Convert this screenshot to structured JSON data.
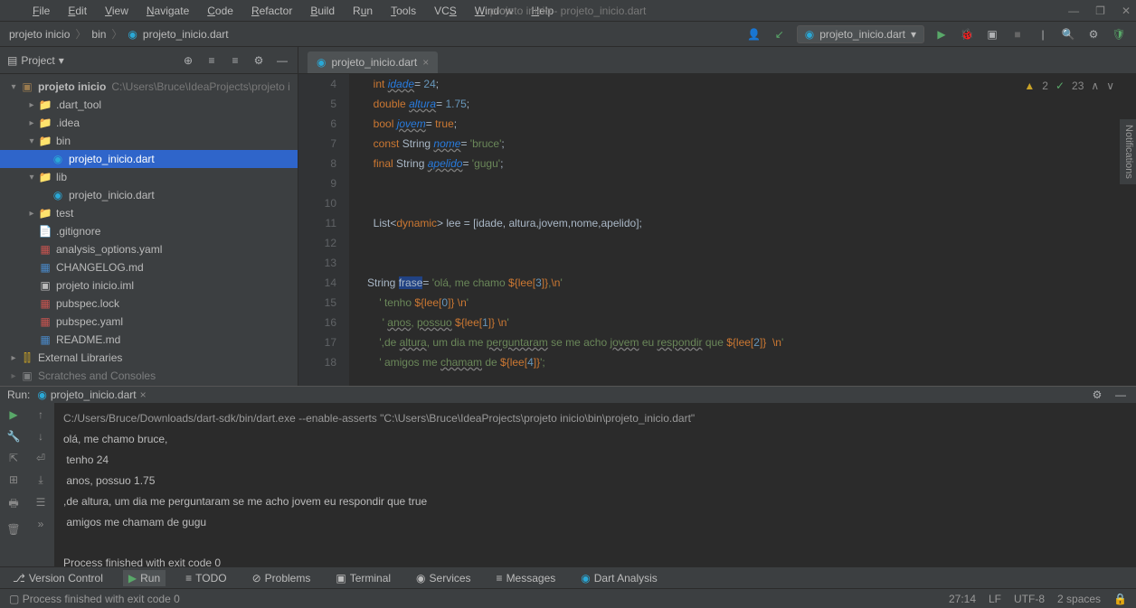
{
  "window": {
    "title": "projeto inicio - projeto_inicio.dart"
  },
  "menu": {
    "file": "File",
    "edit": "Edit",
    "view": "View",
    "navigate": "Navigate",
    "code": "Code",
    "refactor": "Refactor",
    "build": "Build",
    "run": "Run",
    "tools": "Tools",
    "vcs": "VCS",
    "window": "Window",
    "help": "Help"
  },
  "breadcrumb": {
    "a": "projeto inicio",
    "b": "bin",
    "c": "projeto_inicio.dart"
  },
  "runConfig": {
    "label": "projeto_inicio.dart"
  },
  "projectPanel": {
    "title": "Project"
  },
  "tree": {
    "root": {
      "name": "projeto inicio",
      "path": "C:\\Users\\Bruce\\IdeaProjects\\projeto i"
    },
    "dart_tool": ".dart_tool",
    "idea": ".idea",
    "bin": "bin",
    "bin_file": "projeto_inicio.dart",
    "lib": "lib",
    "lib_file": "projeto_inicio.dart",
    "test": "test",
    "gitignore": ".gitignore",
    "analysis": "analysis_options.yaml",
    "changelog": "CHANGELOG.md",
    "iml": "projeto inicio.iml",
    "publock": "pubspec.lock",
    "pubyaml": "pubspec.yaml",
    "readme": "README.md",
    "extlib": "External Libraries",
    "scratches": "Scratches and Consoles"
  },
  "tab": {
    "name": "projeto_inicio.dart"
  },
  "badges": {
    "warn": "2",
    "ok": "23"
  },
  "gutter": [
    "4",
    "5",
    "6",
    "7",
    "8",
    "9",
    "10",
    "11",
    "12",
    "13",
    "14",
    "15",
    "16",
    "17",
    "18"
  ],
  "code": {
    "l4": {
      "kw": "int",
      "var": "idade",
      "val": "24"
    },
    "l5": {
      "kw": "double",
      "var": "altura",
      "val": "1.75"
    },
    "l6": {
      "kw": "bool",
      "var": "jovem",
      "val": "true"
    },
    "l7": {
      "kw": "const",
      "type": "String",
      "var": "nome",
      "val": "'bruce'"
    },
    "l8": {
      "kw": "final",
      "type": "String",
      "var": "apelido",
      "val": "'gugu'"
    },
    "l11": {
      "text": "List<dynamic> lee = [idade, altura,jovem,nome,apelido];"
    },
    "l14": {
      "pre": "String ",
      "frase": "frase",
      "t1": "= ",
      "s1": "'olá, me chamo ",
      "i1": "${lee[",
      "n1": "3",
      "i2": "]}",
      "s2": ",",
      "esc": "\\n",
      "s3": "'"
    },
    "l15": {
      "s1": "' tenho ",
      "i1": "${lee[",
      "n1": "0",
      "i2": "]}",
      "s2": " ",
      "esc": "\\n",
      "s3": "'"
    },
    "l16": {
      "s1": "' ",
      "w1": "anos",
      "s2": ", ",
      "w2": "possuo",
      "s3": " ",
      "i1": "${lee[",
      "n1": "1",
      "i2": "]}",
      "s4": " ",
      "esc": "\\n",
      "s5": "'"
    },
    "l17": {
      "s1": "',de ",
      "w1": "altura",
      "s2": ", um dia me ",
      "w2": "perguntaram",
      "s3": " se me acho ",
      "w3": "jovem",
      "s4": " eu ",
      "w4": "respondir",
      "s5": " que ",
      "i1": "${lee[",
      "n1": "2",
      "i2": "]}",
      "s6": "  ",
      "esc": "\\n",
      "s7": "'"
    },
    "l18": {
      "s1": "' amigos me ",
      "w1": "chamam",
      "s2": " de ",
      "i1": "${lee[",
      "n1": "4",
      "i2": "]}",
      "s3": "';"
    }
  },
  "run": {
    "label": "Run:",
    "tab": "projeto_inicio.dart",
    "cmd": "C:/Users/Bruce/Downloads/dart-sdk/bin/dart.exe --enable-asserts \"C:\\Users\\Bruce\\IdeaProjects\\projeto inicio\\bin\\projeto_inicio.dart\"",
    "out1": "olá, me chamo bruce,",
    "out2": " tenho 24",
    "out3": " anos, possuo 1.75",
    "out4": ",de altura, um dia me perguntaram se me acho jovem eu respondir que true",
    "out5": " amigos me chamam de gugu",
    "exit": "Process finished with exit code 0"
  },
  "bottomTabs": {
    "vc": "Version Control",
    "run": "Run",
    "todo": "TODO",
    "problems": "Problems",
    "terminal": "Terminal",
    "services": "Services",
    "messages": "Messages",
    "dart": "Dart Analysis"
  },
  "status": {
    "msg": "Process finished with exit code 0",
    "pos": "27:14",
    "le": "LF",
    "enc": "UTF-8",
    "indent": "2 spaces"
  },
  "sideTab": "Notifications"
}
